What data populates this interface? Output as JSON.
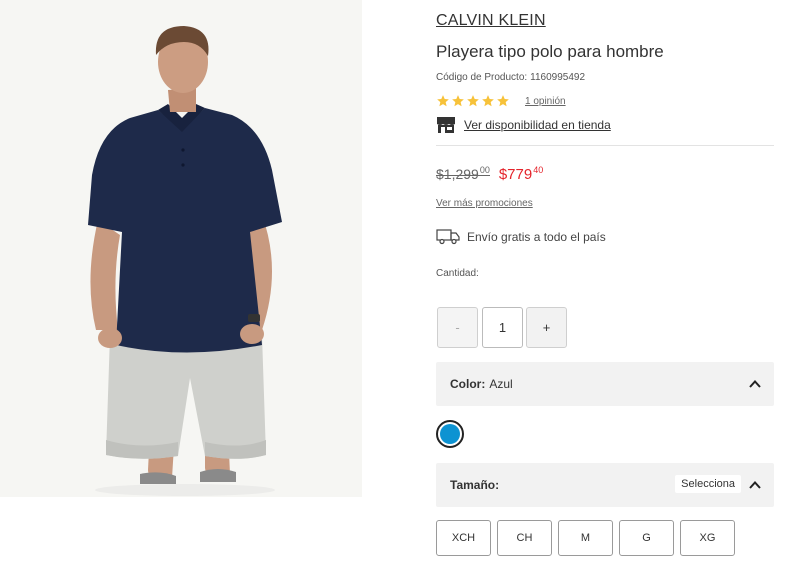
{
  "product": {
    "brand": "CALVIN KLEIN",
    "title": "Playera tipo polo para hombre",
    "code_label": "Código de Producto:",
    "code_value": "1160995492",
    "rating_stars": 5,
    "reviews_text": "1 opinión",
    "availability_text": "Ver disponibilidad en tienda"
  },
  "price": {
    "original": "$1,299",
    "original_cents": "00",
    "sale": "$779",
    "sale_cents": "40",
    "sale_color": "#e4232b",
    "promotions_link": "Ver más promociones"
  },
  "shipping": {
    "text": "Envío gratis a todo el país"
  },
  "quantity": {
    "label": "Cantidad:",
    "minus": "-",
    "value": "1",
    "plus": "+"
  },
  "color": {
    "label": "Color:",
    "value": "Azul",
    "swatch_color": "#0d93d2"
  },
  "size": {
    "label": "Tamaño:",
    "select_tag": "Selecciona",
    "options": [
      "XCH",
      "CH",
      "M",
      "G",
      "XG"
    ]
  },
  "icons": {
    "star": "star-icon",
    "store": "store-icon",
    "truck": "truck-icon",
    "chevron": "chevron-up-icon"
  }
}
